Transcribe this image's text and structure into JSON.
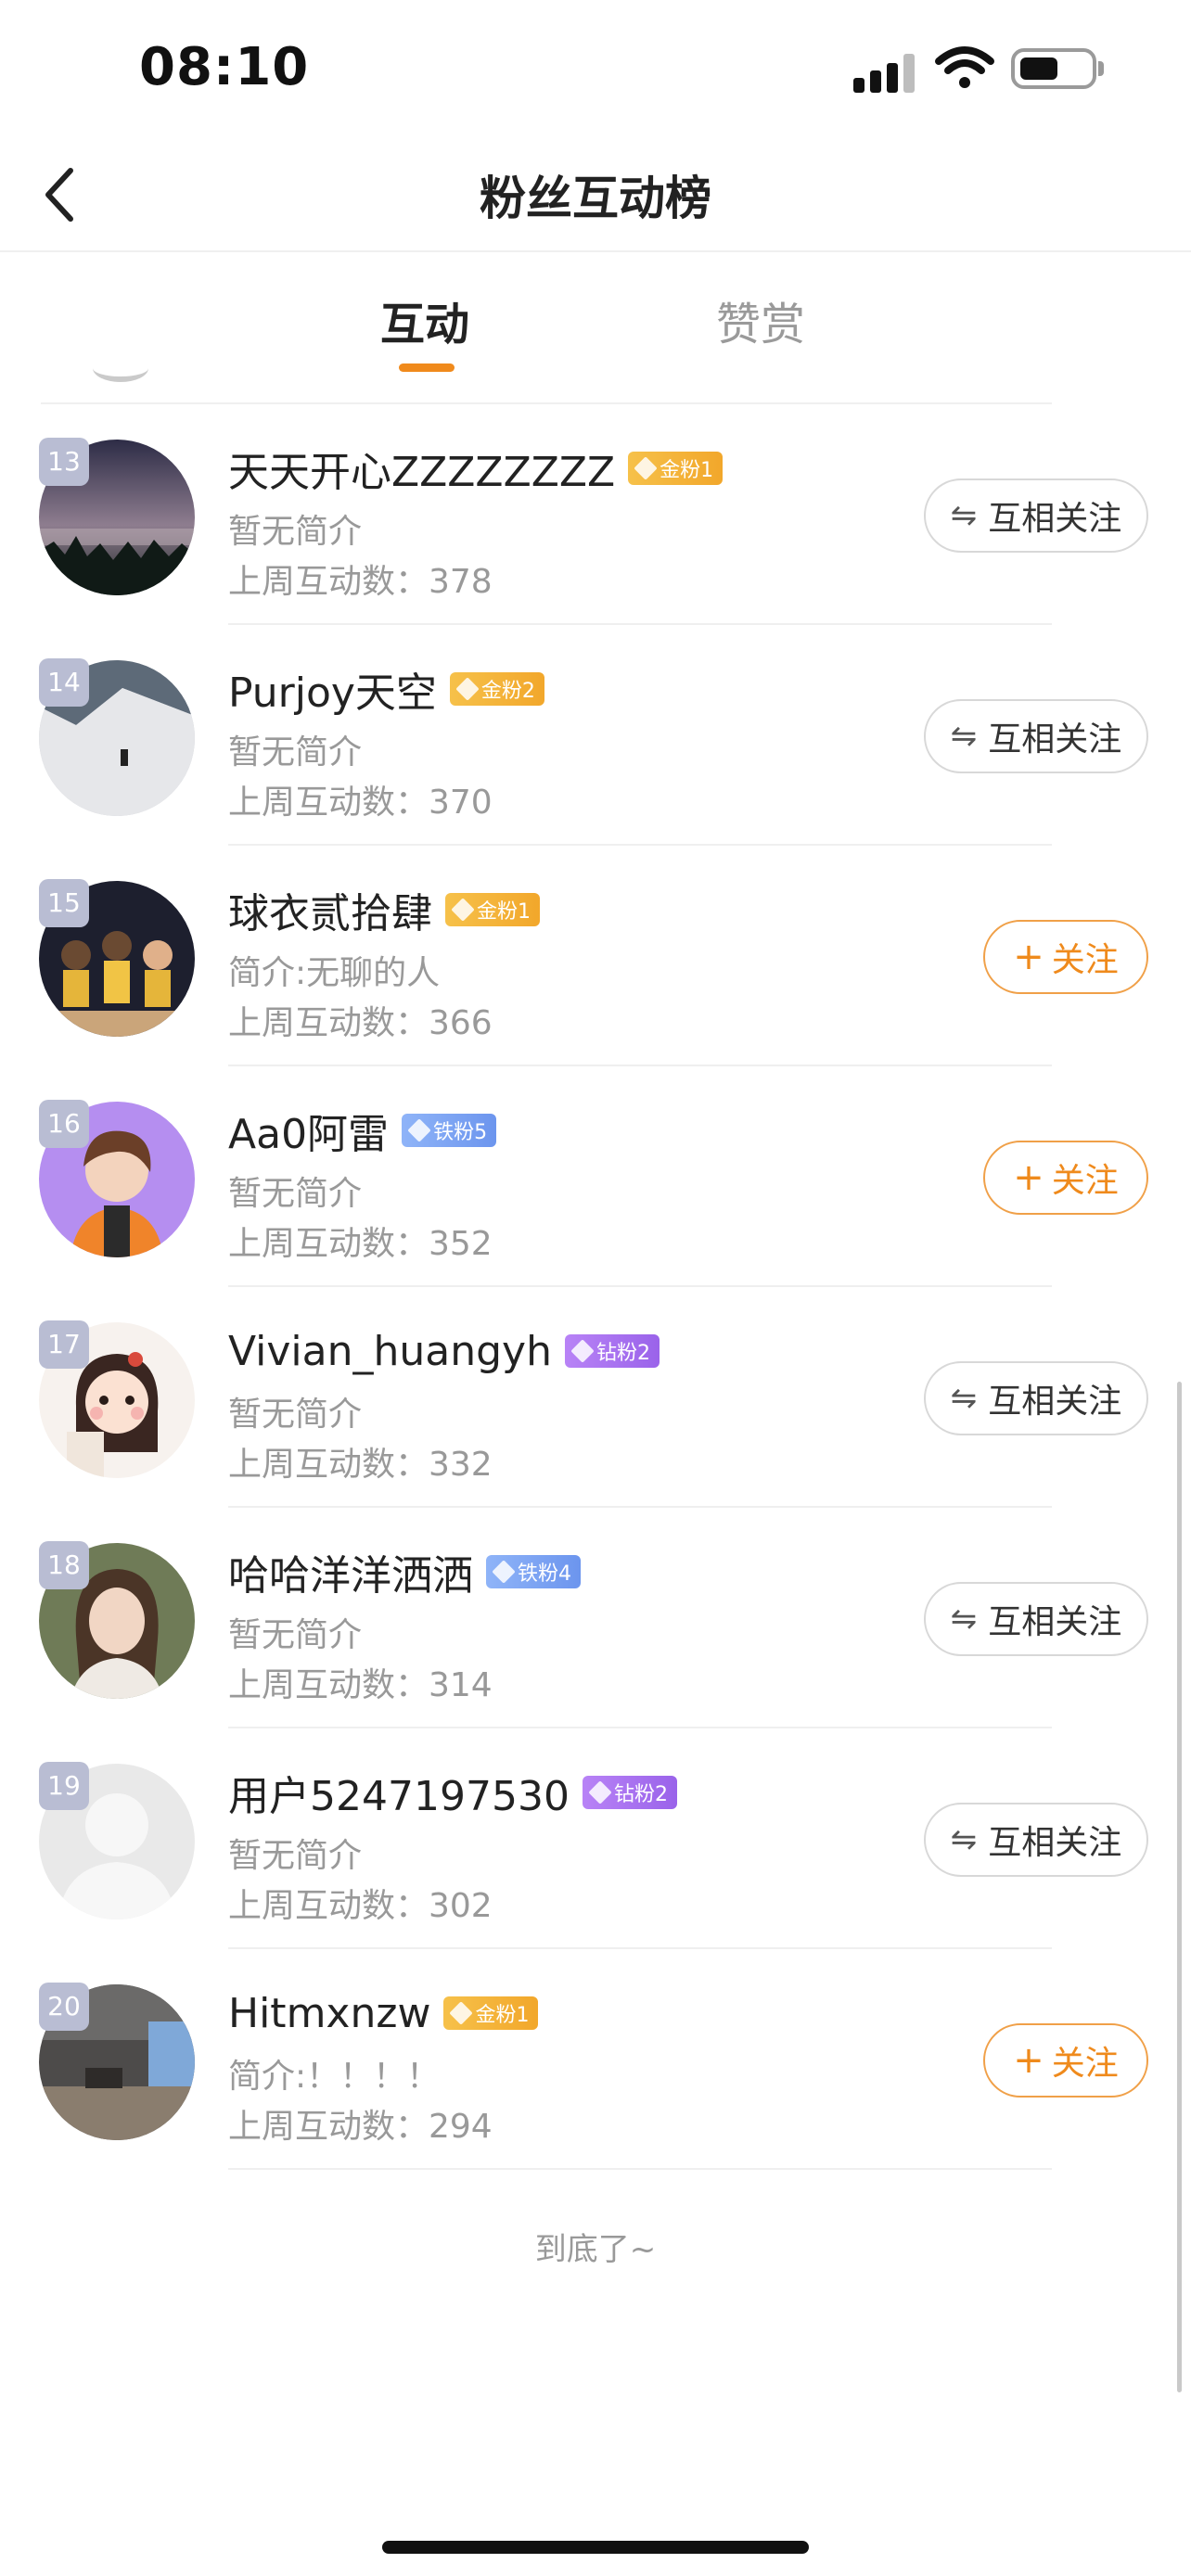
{
  "status_bar": {
    "time": "08:10"
  },
  "nav": {
    "title": "粉丝互动榜"
  },
  "tabs": [
    {
      "label": "互动",
      "active": true
    },
    {
      "label": "赞赏",
      "active": false
    }
  ],
  "accent_color": "#ef8a1c",
  "list": [
    {
      "rank": "13",
      "name": "天天开心ZZZZZZZZ",
      "badge": "金粉1",
      "badge_type": "gold",
      "intro": "暂无简介",
      "stats": "上周互动数：378",
      "action": "互相关注",
      "action_type": "mutual"
    },
    {
      "rank": "14",
      "name": "Purjoy天空",
      "badge": "金粉2",
      "badge_type": "gold",
      "intro": "暂无简介",
      "stats": "上周互动数：370",
      "action": "互相关注",
      "action_type": "mutual"
    },
    {
      "rank": "15",
      "name": "球衣贰拾肆",
      "badge": "金粉1",
      "badge_type": "gold",
      "intro": "简介:无聊的人",
      "stats": "上周互动数：366",
      "action": "关注",
      "action_type": "follow"
    },
    {
      "rank": "16",
      "name": "Aa0阿雷",
      "badge": "铁粉5",
      "badge_type": "iron",
      "intro": "暂无简介",
      "stats": "上周互动数：352",
      "action": "关注",
      "action_type": "follow"
    },
    {
      "rank": "17",
      "name": "Vivian_huangyh",
      "badge": "钻粉2",
      "badge_type": "diamond",
      "intro": "暂无简介",
      "stats": "上周互动数：332",
      "action": "互相关注",
      "action_type": "mutual"
    },
    {
      "rank": "18",
      "name": "哈哈洋洋洒洒",
      "badge": "铁粉4",
      "badge_type": "iron",
      "intro": "暂无简介",
      "stats": "上周互动数：314",
      "action": "互相关注",
      "action_type": "mutual"
    },
    {
      "rank": "19",
      "name": "用户5247197530",
      "badge": "钻粉2",
      "badge_type": "diamond",
      "intro": "暂无简介",
      "stats": "上周互动数：302",
      "action": "互相关注",
      "action_type": "mutual"
    },
    {
      "rank": "20",
      "name": "Hitmxnzw",
      "badge": "金粉1",
      "badge_type": "gold",
      "intro": "简介:！！！！",
      "stats": "上周互动数：294",
      "action": "关注",
      "action_type": "follow"
    }
  ],
  "footer": {
    "end_text": "到底了~"
  }
}
